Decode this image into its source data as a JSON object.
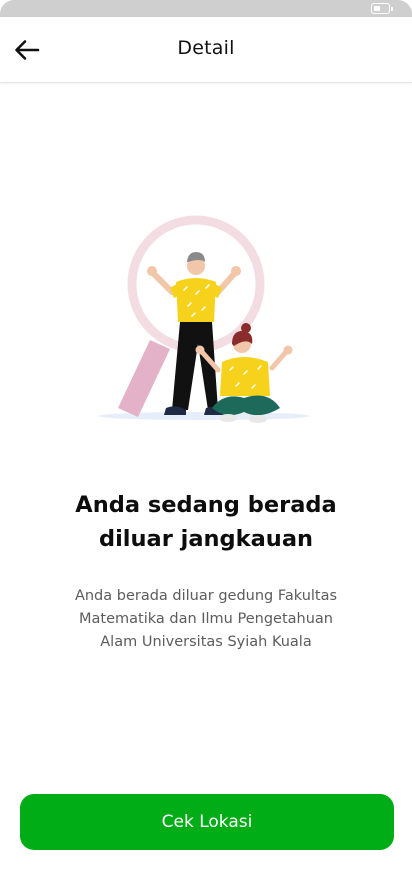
{
  "header": {
    "title": "Detail"
  },
  "icons": {
    "back": "arrow-left-icon",
    "battery": "battery-icon"
  },
  "content": {
    "headline_line1": "Anda sedang berada",
    "headline_line2": "diluar jangkauan",
    "description_line1": "Anda berada diluar gedung Fakultas",
    "description_line2": "Matematika dan Ilmu Pengetahuan",
    "description_line3": "Alam Universitas Syiah Kuala"
  },
  "actions": {
    "primary_label": "Cek Lokasi"
  },
  "colors": {
    "primary": "#00ad16",
    "accent_yellow": "#f7d21c",
    "magnifier_ring": "#f3dde3",
    "magnifier_handle": "#e3b2c8"
  }
}
